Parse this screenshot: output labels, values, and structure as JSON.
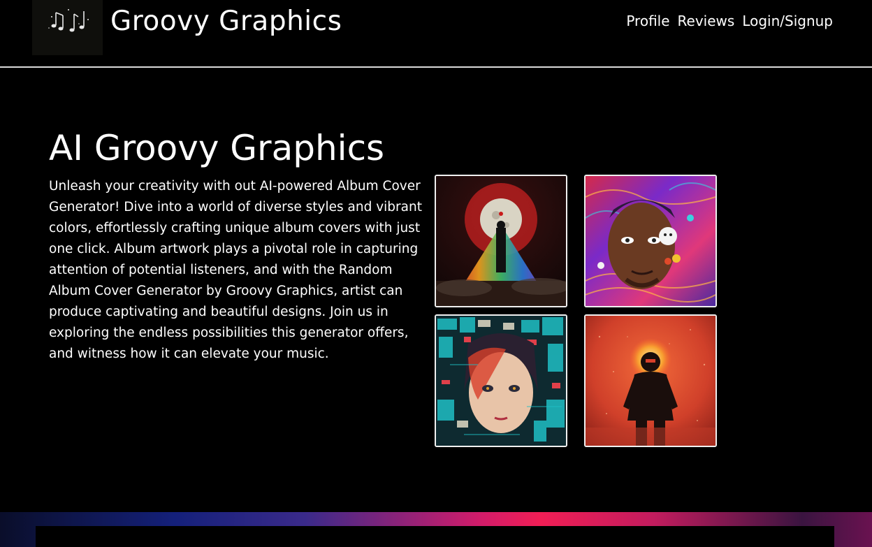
{
  "header": {
    "logo_icon": "music-notes-icon",
    "title": "Groovy Graphics",
    "nav": [
      {
        "label": "Profile"
      },
      {
        "label": "Reviews"
      },
      {
        "label": "Login/Signup"
      }
    ]
  },
  "hero": {
    "title": "AI Groovy Graphics",
    "description": "Unleash your creativity with out AI-powered Album Cover Generator! Dive into a world of diverse styles and vibrant colors, effortlessly crafting unique album covers with just one click. Album artwork plays a pivotal role in capturing attention of potential listeners, and with the Random Album Cover Generator by Groovy Graphics, artist can produce captivating and beautiful designs. Join us in exploring the endless possibilities this generator offers, and witness how it can elevate your music."
  },
  "gallery": {
    "items": [
      {
        "icon": "album-cover-moon-figure"
      },
      {
        "icon": "album-cover-psychedelic-portrait"
      },
      {
        "icon": "album-cover-cyberpunk-girl"
      },
      {
        "icon": "album-cover-fire-astronaut"
      }
    ]
  },
  "colors": {
    "background": "#000000",
    "text": "#ffffff",
    "header_rule": "#d9d9d9",
    "footer_pink": "#f01e55",
    "footer_blue": "#14207a"
  }
}
